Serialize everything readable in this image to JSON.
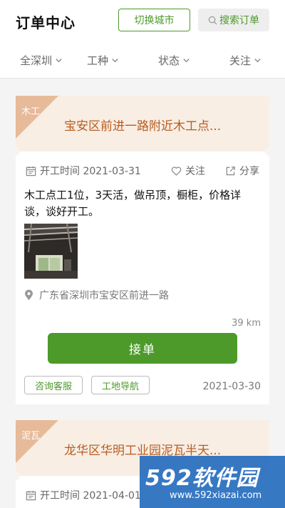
{
  "header": {
    "title": "订单中心",
    "switch_city": "切换城市",
    "search_orders": "搜索订单"
  },
  "filters": [
    {
      "label": "全深圳"
    },
    {
      "label": "工种"
    },
    {
      "label": "状态"
    },
    {
      "label": "关注"
    }
  ],
  "orders": [
    {
      "tag": "木工",
      "title": "宝安区前进一路附近木工点...",
      "start_time": "开工时间 2021-03-31",
      "follow": "关注",
      "share": "分享",
      "description": "木工点工1位，3天活，做吊顶，橱柜，价格详谈，谈好开工。",
      "address": "广东省深圳市宝安区前进一路",
      "distance": "39 km",
      "accept": "接单",
      "consult": "咨询客服",
      "navigate": "工地导航",
      "date": "2021-03-30"
    },
    {
      "tag": "泥瓦",
      "title": "龙华区华明工业园泥瓦半天...",
      "start_time": "开工时间 2021-04-01"
    }
  ],
  "watermark": {
    "logo": "592软件园",
    "url": "www.592xiazai.com"
  },
  "colors": {
    "accent": "#4d9a2b",
    "title_orange": "#b85c22",
    "card_header_bg": "#f8eee3",
    "tag_bg": "#e7ba99"
  }
}
